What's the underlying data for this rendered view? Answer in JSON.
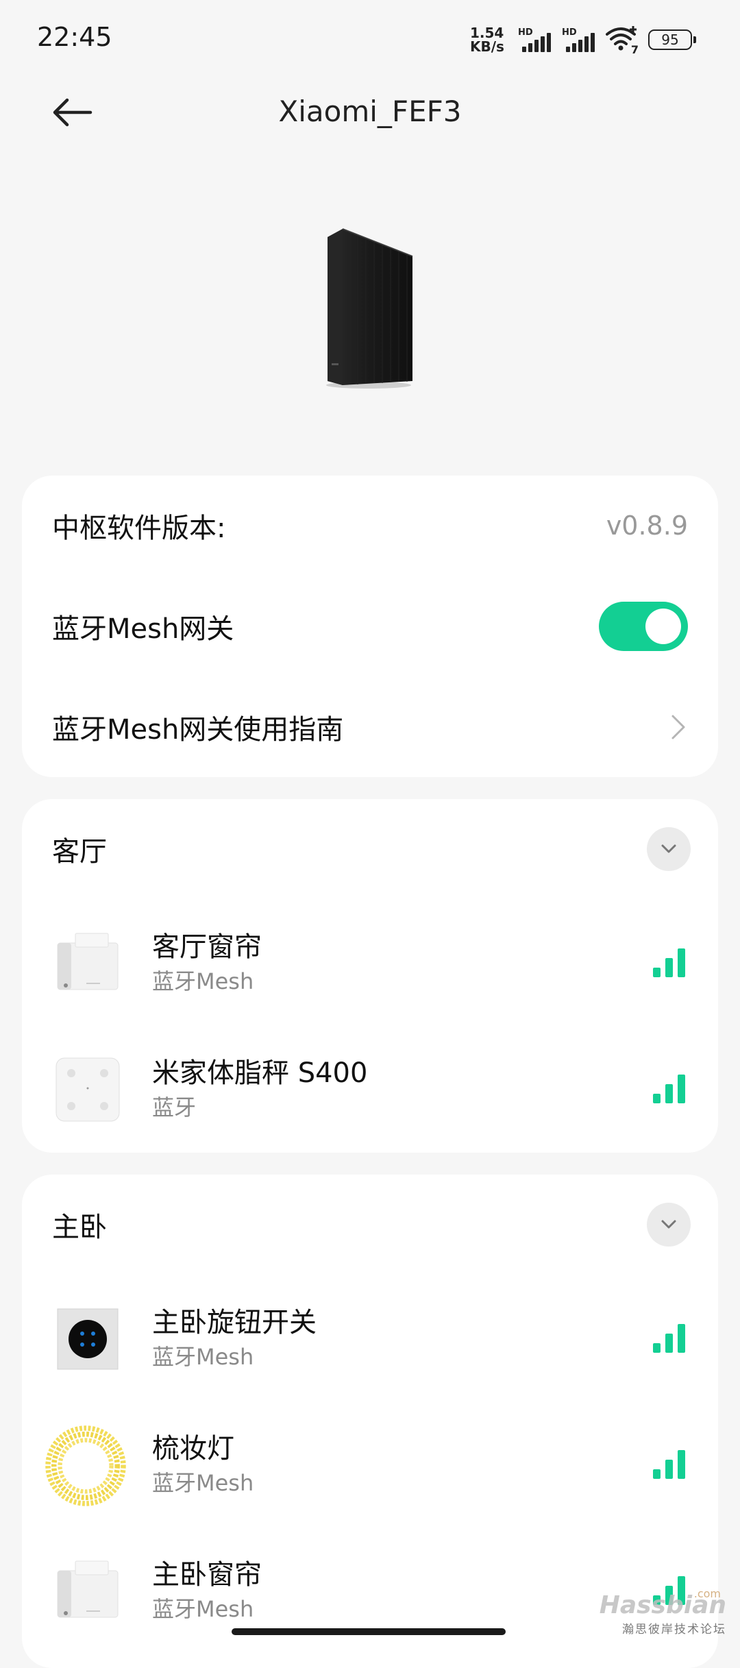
{
  "status_bar": {
    "time": "22:45",
    "net_speed_value": "1.54",
    "net_speed_unit": "KB/s",
    "sim1_tag": "HD",
    "sim2_tag": "HD",
    "wifi_tag": "7",
    "battery": "95"
  },
  "header": {
    "back_icon": "arrow-left-icon",
    "title": "Xiaomi_FEF3"
  },
  "settings": {
    "firmware_label": "中枢软件版本:",
    "firmware_value": "v0.8.9",
    "mesh_gateway_label": "蓝牙Mesh网关",
    "mesh_gateway_enabled": true,
    "guide_label": "蓝牙Mesh网关使用指南"
  },
  "rooms": [
    {
      "name": "客厅",
      "devices": [
        {
          "name": "客厅窗帘",
          "type": "蓝牙Mesh",
          "signal_bars": 3,
          "icon": "curtain-motor"
        },
        {
          "name": "米家体脂秤 S400",
          "type": "蓝牙",
          "signal_bars": 3,
          "icon": "scale"
        }
      ]
    },
    {
      "name": "主卧",
      "devices": [
        {
          "name": "主卧旋钮开关",
          "type": "蓝牙Mesh",
          "signal_bars": 3,
          "icon": "knob-switch"
        },
        {
          "name": "梳妆灯",
          "type": "蓝牙Mesh",
          "signal_bars": 3,
          "icon": "light-strip"
        },
        {
          "name": "主卧窗帘",
          "type": "蓝牙Mesh",
          "signal_bars": 3,
          "icon": "curtain-motor"
        }
      ]
    }
  ],
  "watermark": {
    "main": "Hassbian",
    "suffix": ".com",
    "sub": "瀚思彼岸技术论坛"
  },
  "colors": {
    "accent": "#13cf93",
    "background": "#f6f6f6",
    "card": "#ffffff"
  }
}
